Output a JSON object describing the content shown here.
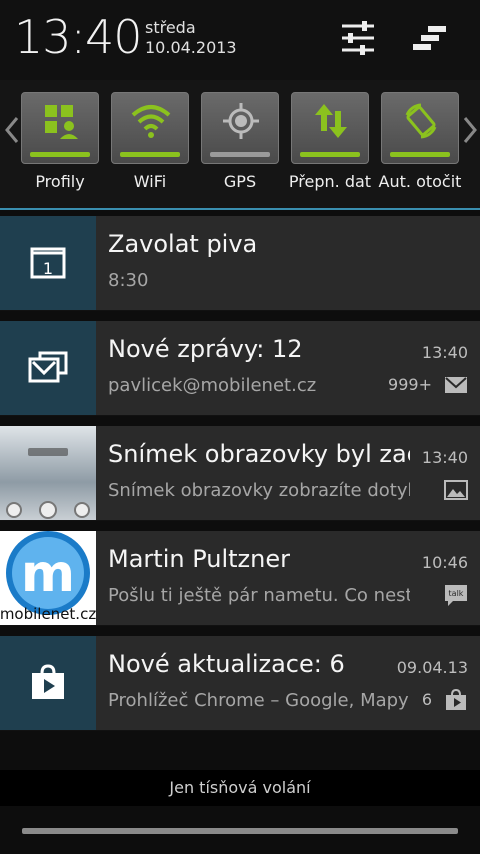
{
  "status": {
    "time": "13:40",
    "day": "středa",
    "date": "10.04.2013"
  },
  "toggles": [
    {
      "label": "Profily",
      "icon": "profiles-icon",
      "active": true
    },
    {
      "label": "WiFi",
      "icon": "wifi-icon",
      "active": true
    },
    {
      "label": "GPS",
      "icon": "gps-icon",
      "active": false
    },
    {
      "label": "Přepn. dat",
      "icon": "data-switch-icon",
      "active": true
    },
    {
      "label": "Aut. otočit",
      "icon": "auto-rotate-icon",
      "active": true
    }
  ],
  "notifications": [
    {
      "title": "Zavolat piva",
      "subtitle": "8:30",
      "time": "",
      "count": "",
      "icon": "calendar-icon"
    },
    {
      "title": "Nové zprávy: 12",
      "subtitle": "pavlicek@mobilenet.cz",
      "time": "13:40",
      "count": "999+",
      "icon": "email-icon"
    },
    {
      "title": "Snímek obrazovky byl zachycen",
      "subtitle": "Snímek obrazovky zobrazíte dotykem",
      "time": "13:40",
      "count": "",
      "icon": "screenshot-thumbnail"
    },
    {
      "title": "Martin Pultzner",
      "subtitle": "Pošlu ti ještě pár nametu. Co nestihneš",
      "time": "10:46",
      "count": "",
      "icon": "talk-icon",
      "logo_text": "mobilenet.cz"
    },
    {
      "title": "Nové aktualizace: 6",
      "subtitle": "Prohlížeč Chrome – Google, Mapy",
      "time": "09.04.13",
      "count": "6",
      "icon": "play-store-icon"
    }
  ],
  "footer": {
    "emergency": "Jen tísňová volání"
  },
  "colors": {
    "accent_green": "#8bc21e",
    "accent_blue": "#3a8fb0",
    "icon_bg": "#1f3f4f"
  }
}
